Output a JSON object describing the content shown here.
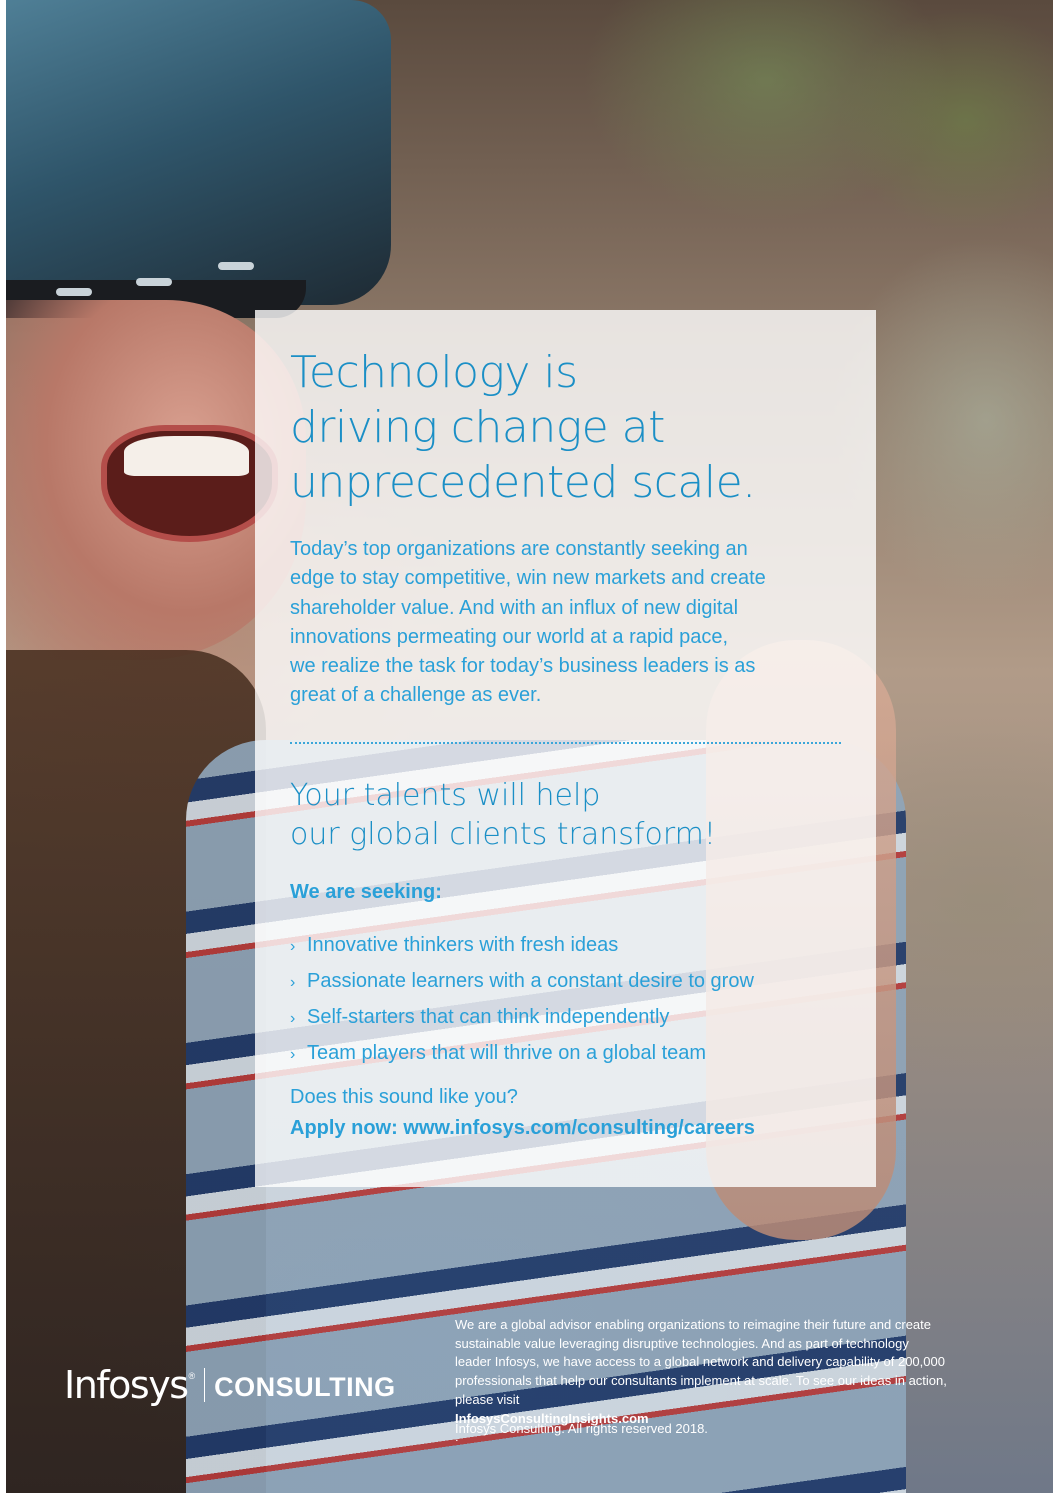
{
  "headline": {
    "lines": [
      "Technology is",
      "driving change at",
      "unprecedented scale."
    ]
  },
  "intro": {
    "lines": [
      "Today’s top organizations are constantly seeking an",
      "edge to stay competitive, win new markets and create",
      "shareholder value. And with an influx of new digital",
      "innovations permeating our world at a rapid pace,",
      "we realize the task for today’s business leaders is as",
      "great of a challenge as ever."
    ]
  },
  "subhead": {
    "lines": [
      "Your talents will help",
      "our global clients transform!"
    ]
  },
  "seeking": {
    "label": "We are seeking:",
    "bullet_glyph": "›",
    "items": [
      "Innovative thinkers with fresh ideas",
      "Passionate learners with a constant desire to grow",
      "Self-starters that can think independently",
      "Team players that will thrive on a global team"
    ]
  },
  "cta": {
    "question": "Does this sound like you?",
    "apply": "Apply now: www.infosys.com/consulting/careers"
  },
  "logo": {
    "brand": "Infosys",
    "registered": "®",
    "division": "CONSULTING"
  },
  "footer": {
    "about_lines": [
      "We are a global advisor enabling organizations to reimagine their future and create",
      "sustainable value leveraging disruptive technologies. And as part of technology",
      "leader Infosys, we have access to a global network and delivery capability of 200,000",
      "professionals that help our consultants implement at scale. To see our ideas in action,"
    ],
    "visit_prefix": "please visit ",
    "visit_link": "InfosysConsultingInsights.com",
    "visit_suffix": ".",
    "copyright": "Infosys Consulting. All rights reserved 2018."
  },
  "colors": {
    "primary_blue": "#1b8fc6",
    "text_blue": "#2aa0d8",
    "footer_text": "#ffffff"
  }
}
